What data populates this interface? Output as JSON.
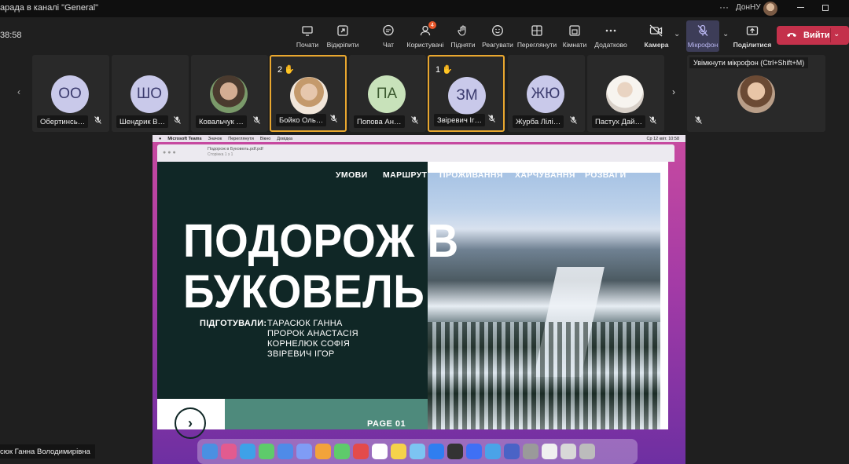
{
  "window": {
    "title": "арада в каналі \"General\"",
    "more": "···",
    "user": "ДонНУ"
  },
  "meeting": {
    "timer": "38:58",
    "toolbar": [
      {
        "label": "Почати",
        "icon": "record-icon"
      },
      {
        "label": "Відкріпити",
        "icon": "unpin-icon"
      },
      {
        "label": "Чат",
        "icon": "chat-icon"
      },
      {
        "label": "Користувачі",
        "icon": "people-icon",
        "badge": "4"
      },
      {
        "label": "Підняти",
        "icon": "raise-hand-icon"
      },
      {
        "label": "Реагувати",
        "icon": "react-icon"
      },
      {
        "label": "Переглянути",
        "icon": "view-icon"
      },
      {
        "label": "Кімнати",
        "icon": "rooms-icon"
      },
      {
        "label": "Додатково",
        "icon": "more-icon"
      },
      {
        "label": "Камера",
        "icon": "camera-off-icon"
      },
      {
        "label": "Мікрофон",
        "icon": "mic-off-icon"
      },
      {
        "label": "Поділитися",
        "icon": "share-icon"
      }
    ],
    "leave_label": "Вийти",
    "mic_tooltip": "Увімкнути мікрофон (Ctrl+Shift+M)"
  },
  "participants": [
    {
      "initials": "ОО",
      "name": "Обертинсь…",
      "style": "initials"
    },
    {
      "initials": "ШО",
      "name": "Шендрик В…",
      "style": "initials"
    },
    {
      "initials": "",
      "name": "Ковальчук …",
      "style": "photo1"
    },
    {
      "initials": "",
      "name": "Бойко Оль…",
      "style": "photo2",
      "hand": "2"
    },
    {
      "initials": "ПА",
      "name": "Попова Ан…",
      "style": "green"
    },
    {
      "initials": "ЗМ",
      "name": "Звіревич Іг…",
      "style": "initials",
      "hand": "1"
    },
    {
      "initials": "ЖЮ",
      "name": "Журба Лілі…",
      "style": "initials"
    },
    {
      "initials": "",
      "name": "Пастух Дай…",
      "style": "photo3"
    }
  ],
  "shared": {
    "mac_menu": [
      "Microsoft Teams",
      "Значок",
      "Переглянути",
      "Вікно",
      "Довідка"
    ],
    "mac_status": "Ср 12 квіт. 10:58",
    "doc_title": "Подорож в Буковель.pdf.pdf",
    "doc_subtitle": "Сторінка 1 з 1",
    "slide": {
      "nav": [
        "УМОВИ",
        "МАРШРУТ",
        "ПРОЖИВАННЯ",
        "ХАРЧУВАННЯ",
        "РОЗВАГИ"
      ],
      "title_line1": "ПОДОРОЖ В",
      "title_line2": "БУКОВЕЛЬ",
      "prepared_label": "ПІДГОТУВАЛИ:",
      "authors": [
        "ТАРАСЮК ГАННА",
        "ПРОРОК АНАСТАСІЯ",
        "КОРНЕЛЮК СОФІЯ",
        "ЗВІРЕВИЧ ІГОР"
      ],
      "page": "PAGE 01"
    },
    "dock_colors": [
      "#4a90e2",
      "#e25b8f",
      "#3ea1e8",
      "#5ecb6b",
      "#4f8be8",
      "#7f9cf5",
      "#f2a33a",
      "#5ecb6b",
      "#e34b4b",
      "#ffffff",
      "#f5d34a",
      "#7cc4f2",
      "#2f7ef0",
      "#333333",
      "#3f70f5",
      "#4aa3e8",
      "#4a63c6",
      "#9a9a9a",
      "#f0f0f0",
      "#d8d8d8",
      "#bcbcbc"
    ]
  },
  "presenter_label": "сюк Ганна Володимирівна"
}
